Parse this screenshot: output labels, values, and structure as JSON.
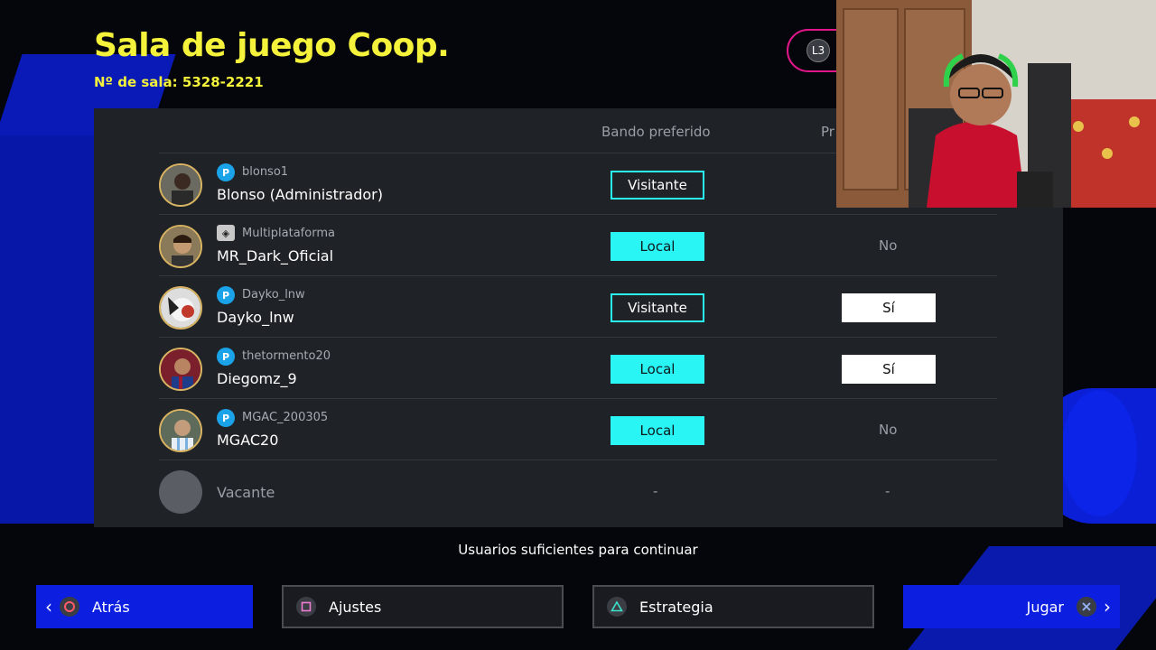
{
  "header": {
    "title": "Sala de juego Coop.",
    "room_number": "Nº de sala: 5328-2221",
    "l3_label": "L3"
  },
  "table": {
    "columns": [
      "Bando preferido",
      "Pr"
    ],
    "rows": [
      {
        "platform": "psn",
        "handle": "blonso1",
        "name": "Blonso (Administrador)",
        "side": "Visitante",
        "ready": ""
      },
      {
        "platform": "multi",
        "handle": "Multiplataforma",
        "name": "MR_Dark_Oficial",
        "side": "Local",
        "ready": "No"
      },
      {
        "platform": "psn",
        "handle": "Dayko_lnw",
        "name": "Dayko_lnw",
        "side": "Visitante",
        "ready": "Sí"
      },
      {
        "platform": "psn",
        "handle": "thetormento20",
        "name": "Diegomz_9",
        "side": "Local",
        "ready": "Sí"
      },
      {
        "platform": "psn",
        "handle": "MGAC_200305",
        "name": "MGAC20",
        "side": "Local",
        "ready": "No"
      },
      {
        "platform": "",
        "handle": "",
        "name": "Vacante",
        "side": "-",
        "ready": "-"
      }
    ]
  },
  "status": "Usuarios suficientes para continuar",
  "buttons": {
    "back": "Atrás",
    "settings": "Ajustes",
    "strategy": "Estrategia",
    "play": "Jugar"
  },
  "colors": {
    "title_yellow": "#f4f23a",
    "local_cyan": "#29f5f5",
    "accent_blue": "#0c1ee0",
    "l3_magenta": "#e0168a"
  }
}
